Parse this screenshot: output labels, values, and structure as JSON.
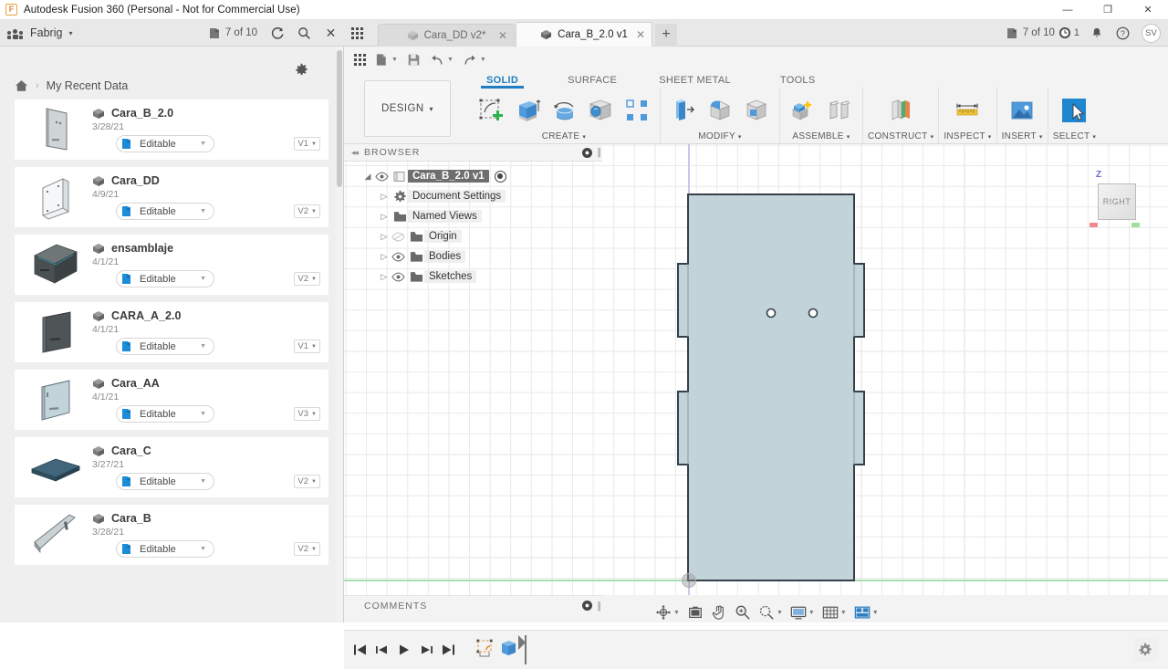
{
  "window": {
    "title": "Autodesk Fusion 360 (Personal - Not for Commercial Use)",
    "app_icon": "F",
    "minimize": "—",
    "maximize": "❐",
    "close": "✕"
  },
  "topbar": {
    "team_name": "Fabrig",
    "team_caret": "▾",
    "jobs_left": "7 of 10",
    "jobs_right": "7 of 10",
    "refresh_icon": "refresh-icon",
    "search_icon": "search-icon",
    "close_icon": "✕",
    "notifications_count": "1",
    "avatar_initials": "SV",
    "tabs": [
      {
        "label": "Cara_DD v2*",
        "active": false,
        "closable": true
      },
      {
        "label": "Cara_B_2.0 v1",
        "active": true,
        "closable": true
      }
    ],
    "new_tab_label": "+"
  },
  "quick_access": {
    "items": [
      "grid-icon",
      "file-icon",
      "save-icon",
      "undo-icon",
      "redo-icon"
    ]
  },
  "ribbon": {
    "workspace": "DESIGN",
    "workspace_caret": "▾",
    "tabs": [
      {
        "label": "SOLID",
        "active": true
      },
      {
        "label": "SURFACE",
        "active": false
      },
      {
        "label": "SHEET METAL",
        "active": false
      },
      {
        "label": "TOOLS",
        "active": false
      }
    ],
    "groups": [
      {
        "label": "CREATE",
        "caret": "▾",
        "buttons": [
          "create-sketch-icon",
          "extrude-icon",
          "revolve-icon",
          "sweep-icon",
          "pattern-icon"
        ]
      },
      {
        "label": "MODIFY",
        "caret": "▾",
        "buttons": [
          "press-pull-icon",
          "fillet-icon",
          "shell-icon"
        ]
      },
      {
        "label": "ASSEMBLE",
        "caret": "▾",
        "buttons": [
          "new-component-icon",
          "joint-icon"
        ]
      },
      {
        "label": "CONSTRUCT",
        "caret": "▾",
        "buttons": [
          "offset-plane-icon"
        ]
      },
      {
        "label": "INSPECT",
        "caret": "▾",
        "buttons": [
          "measure-icon"
        ]
      },
      {
        "label": "INSERT",
        "caret": "▾",
        "buttons": [
          "insert-image-icon"
        ]
      },
      {
        "label": "SELECT",
        "caret": "▾",
        "buttons": [
          "select-cursor-icon"
        ]
      }
    ]
  },
  "data_panel": {
    "gear_icon": "gear-icon",
    "breadcrumb_home": "home-icon",
    "breadcrumb_sep": "›",
    "breadcrumb_label": "My Recent Data",
    "editable_label": "Editable",
    "items": [
      {
        "name": "Cara_B_2.0",
        "date": "3/28/21",
        "version": "V1",
        "thumb": "flat-panel-holes"
      },
      {
        "name": "Cara_DD",
        "date": "4/9/21",
        "version": "V2",
        "thumb": "bracket-panel"
      },
      {
        "name": "ensamblaje",
        "date": "4/1/21",
        "version": "V2",
        "thumb": "open-box"
      },
      {
        "name": "CARA_A_2.0",
        "date": "4/1/21",
        "version": "V1",
        "thumb": "dark-panel"
      },
      {
        "name": "Cara_AA",
        "date": "4/1/21",
        "version": "V3",
        "thumb": "light-panel"
      },
      {
        "name": "Cara_C",
        "date": "3/27/21",
        "version": "V2",
        "thumb": "blue-plate"
      },
      {
        "name": "Cara_B",
        "date": "3/28/21",
        "version": "V2",
        "thumb": "grey-panel"
      }
    ]
  },
  "browser": {
    "title": "BROWSER",
    "collapse_icon": "◂◂",
    "dot_icon": "●",
    "nodes": [
      {
        "label": "Cara_B_2.0 v1",
        "level": 0,
        "selected": true,
        "eye": "visible",
        "icon": "component-icon",
        "arrow": "◢",
        "radio": true
      },
      {
        "label": "Document Settings",
        "level": 1,
        "selected": false,
        "eye": "none",
        "icon": "gear-icon",
        "arrow": "▷",
        "radio": false
      },
      {
        "label": "Named Views",
        "level": 1,
        "selected": false,
        "eye": "none",
        "icon": "folder-icon",
        "arrow": "▷",
        "radio": false
      },
      {
        "label": "Origin",
        "level": 1,
        "selected": false,
        "eye": "hidden",
        "icon": "folder-icon",
        "arrow": "▷",
        "radio": false
      },
      {
        "label": "Bodies",
        "level": 1,
        "selected": false,
        "eye": "visible",
        "icon": "folder-icon",
        "arrow": "▷",
        "radio": false
      },
      {
        "label": "Sketches",
        "level": 1,
        "selected": false,
        "eye": "visible",
        "icon": "folder-icon",
        "arrow": "▷",
        "radio": false
      }
    ]
  },
  "viewport": {
    "view_cube_face": "RIGHT",
    "axis_z_label": "Z",
    "body_fill": "#c3d3da",
    "body_stroke": "#36404a",
    "grid_minor_color": "#e9e9e9",
    "grid_major_color": "#cfcfcf",
    "x_axis_color": "#a8dfb0",
    "z_axis_color": "#c8c8e8"
  },
  "comments": {
    "title": "COMMENTS",
    "dot_icon": "●"
  },
  "navbar": {
    "buttons": [
      {
        "name": "orbit-icon",
        "caret": true
      },
      {
        "name": "look-at-icon",
        "caret": false
      },
      {
        "name": "pan-icon",
        "caret": false
      },
      {
        "name": "zoom-icon",
        "caret": false
      },
      {
        "name": "zoom-window-icon",
        "caret": true
      },
      {
        "name": "display-settings-icon",
        "caret": true
      },
      {
        "name": "grid-snaps-icon",
        "caret": true
      },
      {
        "name": "viewports-icon",
        "caret": true
      }
    ]
  },
  "timeline": {
    "buttons": [
      "go-to-beginning-icon",
      "step-back-icon",
      "play-icon",
      "step-forward-icon",
      "go-to-end-icon"
    ],
    "features": [
      "sketch-feature-icon",
      "extrude-feature-icon"
    ],
    "settings_icon": "gear-icon"
  }
}
